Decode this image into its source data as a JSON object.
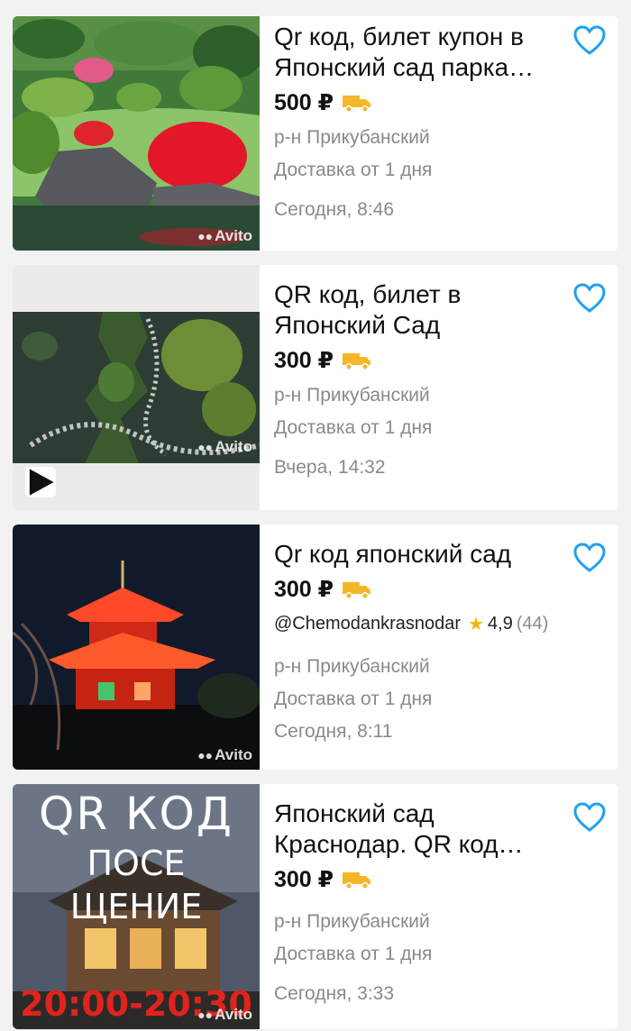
{
  "listings": [
    {
      "title": "Qr код, билет купон в Японский сад парка…",
      "price": "500 ₽",
      "district": "р-н Прикубанский",
      "delivery": "Доставка от 1 дня",
      "date": "Сегодня, 8:46",
      "watermark": "Avito"
    },
    {
      "title": "QR код, билет в Японский Сад",
      "price": "300 ₽",
      "district": "р-н Прикубанский",
      "delivery": "Доставка от 1 дня",
      "date": "Вчера, 14:32",
      "watermark": "Avito"
    },
    {
      "title": "Qr код японский сад",
      "price": "300 ₽",
      "seller": "@Chemodankrasnodar",
      "rating": "4,9",
      "reviews": "(44)",
      "district": "р-н Прикубанский",
      "delivery": "Доставка от 1 дня",
      "date": "Сегодня, 8:11",
      "watermark": "Avito"
    },
    {
      "title": "Японский сад Краснодар. QR код…",
      "price": "300 ₽",
      "district": "р-н Прикубанский",
      "delivery": "Доставка от 1 дня",
      "date": "Сегодня, 3:33",
      "watermark": "Avito",
      "image_text_1": "QR КОД",
      "image_text_2": "ПОСЕ",
      "image_text_3": "ЩЕНИЕ",
      "image_text_4": "20:00-20:30"
    }
  ],
  "colors": {
    "favorite": "#1ea1f1",
    "delivery_truck": "#f5b72a",
    "rating_star": "#f4b400",
    "muted_text": "#8a8a8a"
  },
  "icons": {
    "favorite": "heart-outline-icon",
    "delivery": "truck-icon",
    "rating": "star-icon",
    "video": "play-icon"
  }
}
